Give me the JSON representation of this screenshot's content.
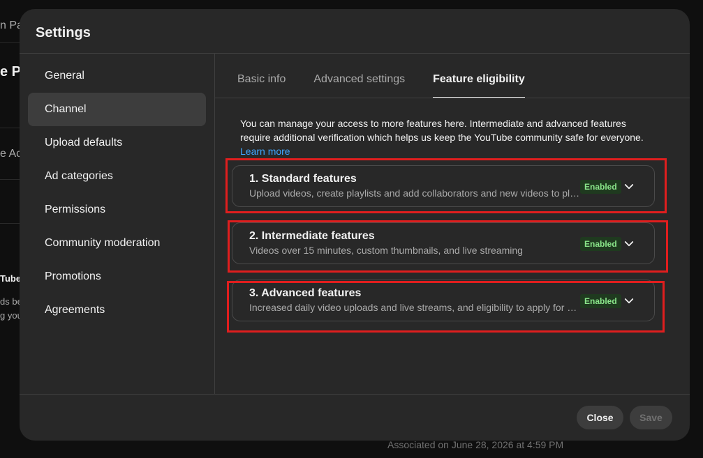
{
  "background": {
    "fragments": [
      "n Pa",
      "e Pa",
      "e Ac",
      "Tube",
      "ds be",
      "g you"
    ],
    "associated_text": "Associated on June 28, 2026 at 4:59 PM"
  },
  "dialog": {
    "title": "Settings",
    "sidebar": {
      "items": [
        {
          "label": "General"
        },
        {
          "label": "Channel"
        },
        {
          "label": "Upload defaults"
        },
        {
          "label": "Ad categories"
        },
        {
          "label": "Permissions"
        },
        {
          "label": "Community moderation"
        },
        {
          "label": "Promotions"
        },
        {
          "label": "Agreements"
        }
      ],
      "active": "Channel"
    },
    "tabs": [
      {
        "label": "Basic info"
      },
      {
        "label": "Advanced settings"
      },
      {
        "label": "Feature eligibility"
      }
    ],
    "active_tab": "Feature eligibility",
    "intro": {
      "text": "You can manage your access to more features here. Intermediate and advanced features require additional verification which helps us keep the YouTube community safe for everyone.",
      "learn_more": "Learn more"
    },
    "features": [
      {
        "title": "1. Standard features",
        "description": "Upload videos, create playlists and add collaborators and new videos to playlists",
        "status": "Enabled",
        "icon": "chevron-down-icon"
      },
      {
        "title": "2. Intermediate features",
        "description": "Videos over 15 minutes, custom thumbnails, and live streaming",
        "status": "Enabled",
        "icon": "chevron-down-icon"
      },
      {
        "title": "3. Advanced features",
        "description": "Increased daily video uploads and live streams, and eligibility to apply for monetization",
        "status": "Enabled",
        "icon": "chevron-down-icon"
      }
    ],
    "footer": {
      "close_label": "Close",
      "save_label": "Save"
    }
  },
  "colors": {
    "dialog_bg": "#282828",
    "page_bg": "#0f0f0f",
    "link": "#3ea6ff",
    "enabled_badge_text": "#8ae68a",
    "highlight_outline": "#e01e1e"
  }
}
